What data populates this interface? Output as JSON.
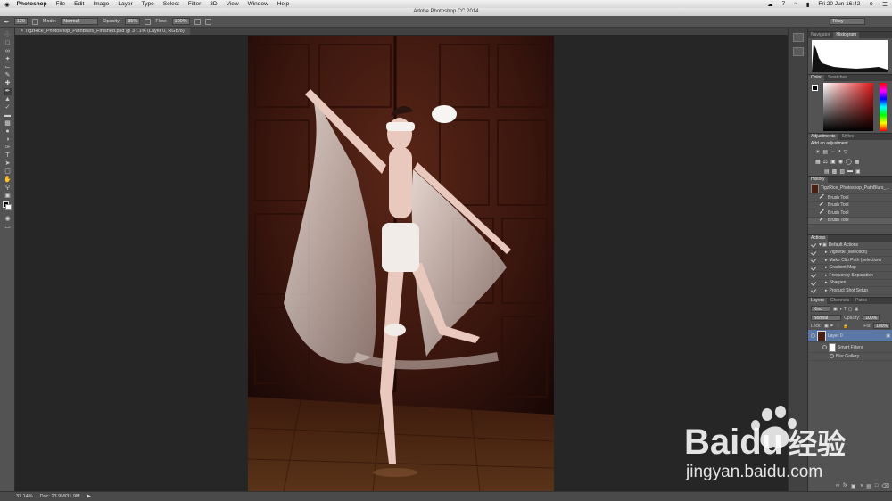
{
  "menubar": {
    "apple": "",
    "app": "Photoshop",
    "items": [
      "File",
      "Edit",
      "Image",
      "Layer",
      "Type",
      "Select",
      "Filter",
      "3D",
      "View",
      "Window",
      "Help"
    ],
    "status_number": "7",
    "clock": "Fri 20 Jun 16:42"
  },
  "titlebar": {
    "title": "Adobe Photoshop CC 2014"
  },
  "options": {
    "brush_size": "120",
    "mode_label": "Mode:",
    "mode_value": "Normal",
    "opacity_label": "Opacity:",
    "opacity_value": "35%",
    "flow_label": "Flow:",
    "flow_value": "100%",
    "workspace": "Tiksy"
  },
  "document": {
    "tab_title": "× TigzRice_Photoshop_PathBlurs_Finished.psd @ 37.1% (Layer 0, RGB/8)"
  },
  "status": {
    "zoom": "37.14%",
    "doc": "Doc: 23.9M/31.9M"
  },
  "panels": {
    "navigator": {
      "tabs": [
        "Navigator",
        "Histogram"
      ]
    },
    "color": {
      "tabs": [
        "Color",
        "Swatches"
      ]
    },
    "adjustments": {
      "tabs": [
        "Adjustments",
        "Styles"
      ],
      "label": "Add an adjustment"
    },
    "history": {
      "tab": "History",
      "snapshot": "TigzRice_Photoshop_PathBlurs_...",
      "items": [
        "Brush Tool",
        "Brush Tool",
        "Brush Tool",
        "Brush Tool"
      ]
    },
    "actions": {
      "tab": "Actions",
      "items": [
        "Default Actions",
        "Vignette (selection)",
        "Make Clip Path (selection)",
        "Gradient Map",
        "Frequency Separation",
        "Sharpen",
        "Product Shot Setup"
      ]
    },
    "layers": {
      "tabs": [
        "Layers",
        "Channels",
        "Paths"
      ],
      "kind": "Kind",
      "blend": "Normal",
      "opacity_label": "Opacity:",
      "opacity_value": "100%",
      "lock_label": "Lock:",
      "fill_label": "Fill:",
      "fill_value": "100%",
      "layer_name": "Layer 0",
      "smart_filters": "Smart Filters",
      "filter_name": "Blur Gallery"
    }
  },
  "watermark": {
    "brand": "Baidu",
    "cn": "经验",
    "url": "jingyan.baidu.com"
  },
  "colors": {
    "accent_layer": "#5a77a8",
    "toolbar": "#535353",
    "canvas": "#262626"
  }
}
